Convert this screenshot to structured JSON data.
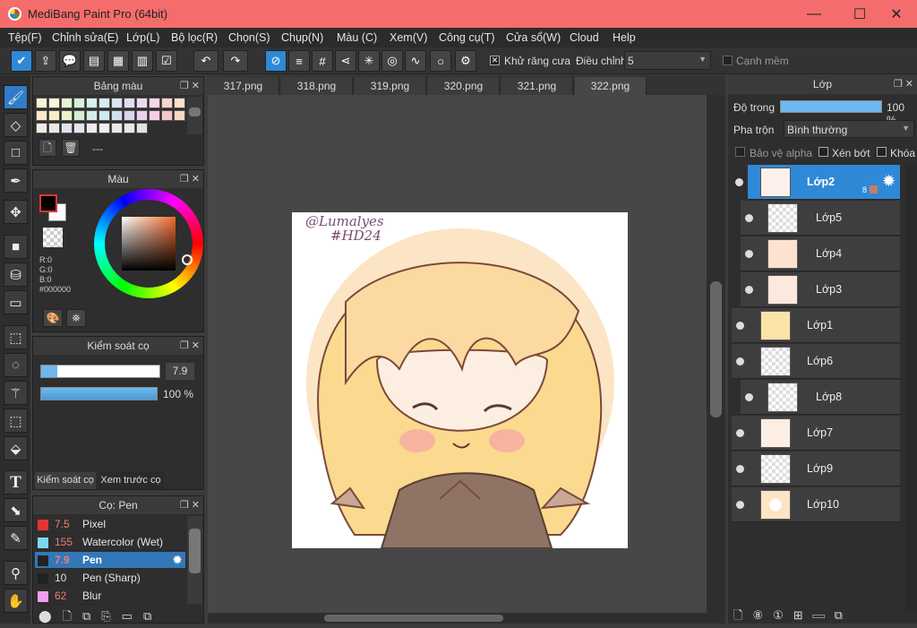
{
  "app": {
    "title": "MediBang Paint Pro (64bit)"
  },
  "window": {
    "minimize": "—",
    "maximize": "☐",
    "close": "✕"
  },
  "menu": [
    "Tệp(F)",
    "Chỉnh sửa(E)",
    "Lớp(L)",
    "Bộ lọc(R)",
    "Chọn(S)",
    "Chụp(N)",
    "Màu (C)",
    "Xem(V)",
    "Công cụ(T)",
    "Cửa sổ(W)",
    "Cloud",
    "Help"
  ],
  "toolbar": {
    "antialias_label": "Khử răng cưa",
    "adjust_label": "Điều chỉnh",
    "adjust_value": "5",
    "soft_edge_label": "Cạnh mềm"
  },
  "tabs": [
    "317.png",
    "318.png",
    "319.png",
    "320.png",
    "321.png",
    "322.png"
  ],
  "palette": {
    "title": "Bảng màu",
    "name": "---",
    "colors": [
      "#fbf2d2",
      "#f9f6d8",
      "#e6f5d5",
      "#d9f1d8",
      "#d6f0ea",
      "#d6ecf2",
      "#d8e4f4",
      "#e2dcf4",
      "#eed9f1",
      "#f8d8e3",
      "#f9d3cf",
      "#fde1c9",
      "#fde8c9",
      "#f8edc6",
      "#eaf3c8",
      "#d4eed0",
      "#d2eee5",
      "#cfe7ef",
      "#d2dcf2",
      "#dcd3f1",
      "#ecd1ef",
      "#f7d0e0",
      "#f4c7c7",
      "#f9d7c2",
      "#f0ece2",
      "#e8e8e8",
      "#e0e4ec",
      "#e8e4ee",
      "#f0eaf0",
      "#f6ebee",
      "#efe7e3",
      "#e9e9e9",
      "#e2e2e2"
    ]
  },
  "color": {
    "title": "Màu",
    "r": "R:0",
    "g": "G:0",
    "b": "B:0",
    "hex": "#000000"
  },
  "brush_control": {
    "title": "Kiểm soát cọ",
    "size": "7.9",
    "opacity": "100 %",
    "tab1": "Kiểm soát cọ",
    "tab2": "Xem trước cọ"
  },
  "brushes": {
    "title": "Cọ: Pen",
    "items": [
      {
        "size": "7.5",
        "name": "Pixel",
        "color": "#e53333"
      },
      {
        "size": "155",
        "name": "Watercolor (Wet)",
        "color": "#7fd8f2"
      },
      {
        "size": "7.9",
        "name": "Pen",
        "color": "#222222"
      },
      {
        "size": "10",
        "name": "Pen (Sharp)",
        "color": "#222222"
      },
      {
        "size": "62",
        "name": "Blur",
        "color": "#f49ef0"
      }
    ]
  },
  "layer_panel": {
    "title": "Lớp",
    "opacity_label": "Độ trong",
    "opacity_value": "100 %",
    "blend_label": "Pha trộn",
    "blend_value": "Bình thường",
    "protect_alpha": "Bảo vệ alpha",
    "clip": "Xén bớt",
    "lock": "Khóa",
    "badge": "8"
  },
  "layers": [
    "Lớp2",
    "Lớp5",
    "Lớp4",
    "Lớp3",
    "Lớp1",
    "Lớp6",
    "Lớp8",
    "Lớp7",
    "Lớp9",
    "Lớp10"
  ],
  "artwork": {
    "signature": "@Lumalyes",
    "tag": "#HD24"
  }
}
